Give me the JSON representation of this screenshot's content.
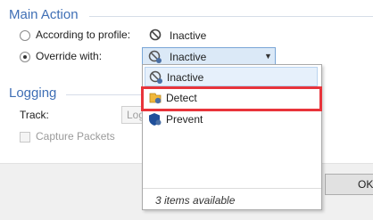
{
  "main_action": {
    "title": "Main Action",
    "according_label": "According to profile:",
    "profile_value": "Inactive",
    "override_label": "Override with:",
    "override_selected": "Inactive"
  },
  "logging": {
    "title": "Logging",
    "track_label": "Track:",
    "track_value": "Log",
    "capture_label": "Capture Packets"
  },
  "dropdown": {
    "items": [
      {
        "label": "Inactive",
        "icon": "inactive-icon"
      },
      {
        "label": "Detect",
        "icon": "detect-icon"
      },
      {
        "label": "Prevent",
        "icon": "prevent-icon"
      }
    ],
    "footer": "3 items available"
  },
  "buttons": {
    "ok_label": "OK"
  },
  "colors": {
    "accent": "#3f6fb5",
    "highlight": "#e8343b",
    "selected_bg": "#dbe9f7"
  }
}
